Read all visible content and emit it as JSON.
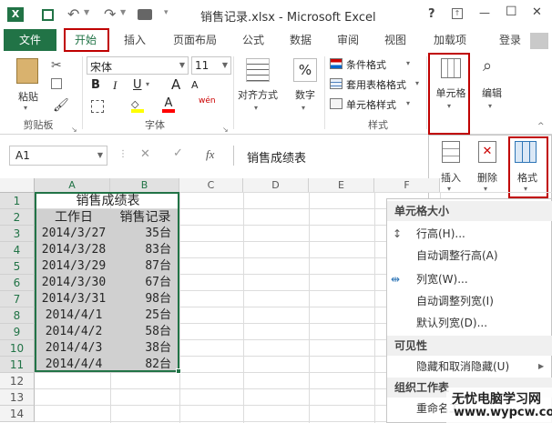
{
  "window": {
    "title": "销售记录.xlsx - Microsoft Excel",
    "help": "?",
    "restore_glyph": "⊼",
    "minimize": "—",
    "maximize": "☐",
    "close": "✕"
  },
  "tabs": [
    "文件",
    "开始",
    "插入",
    "页面布局",
    "公式",
    "数据",
    "审阅",
    "视图",
    "加载项"
  ],
  "login": "登录",
  "ribbon": {
    "paste": "粘贴",
    "clipboard": "剪贴板",
    "font_name": "宋体",
    "font_size": "11",
    "font_group": "字体",
    "bold": "B",
    "italic": "I",
    "underline": "U",
    "grow": "A",
    "shrink": "A",
    "wen": "wén",
    "alignment": "对齐方式",
    "number": "数字",
    "percent": "%",
    "cond_format": "条件格式",
    "table_format": "套用表格格式",
    "cell_style": "单元格样式",
    "style_group": "样式",
    "cells": "单元格",
    "edit": "编辑",
    "insert": "插入",
    "delete": "删除",
    "format": "格式"
  },
  "formula_bar": {
    "name_box": "A1",
    "fx": "fx",
    "content": "销售成绩表"
  },
  "columns": [
    "A",
    "B",
    "C",
    "D",
    "E",
    "F"
  ],
  "rows": [
    "1",
    "2",
    "3",
    "4",
    "5",
    "6",
    "7",
    "8",
    "9",
    "10",
    "11",
    "12",
    "13",
    "14"
  ],
  "sheet": {
    "title": "销售成绩表",
    "header": [
      "工作日",
      "销售记录"
    ],
    "data": [
      [
        "2014/3/27",
        "35台"
      ],
      [
        "2014/3/28",
        "83台"
      ],
      [
        "2014/3/29",
        "87台"
      ],
      [
        "2014/3/30",
        "67台"
      ],
      [
        "2014/3/31",
        "98台"
      ],
      [
        "2014/4/1",
        "25台"
      ],
      [
        "2014/4/2",
        "58台"
      ],
      [
        "2014/4/3",
        "38台"
      ],
      [
        "2014/4/4",
        "82台"
      ]
    ]
  },
  "menu": {
    "h1": "单元格大小",
    "row_height": "行高(H)...",
    "auto_row": "自动调整行高(A)",
    "col_width": "列宽(W)...",
    "auto_col": "自动调整列宽(I)",
    "default_width": "默认列宽(D)...",
    "h2": "可见性",
    "hide": "隐藏和取消隐藏(U)",
    "h3": "组织工作表",
    "rename": "重命名工"
  },
  "watermark": {
    "line1": "无忧电脑学习网",
    "line2": "www.wypcw.com"
  },
  "colors": {
    "excel_green": "#217346",
    "highlight_red": "#c00000",
    "selection_gray": "#d0d0d0"
  }
}
